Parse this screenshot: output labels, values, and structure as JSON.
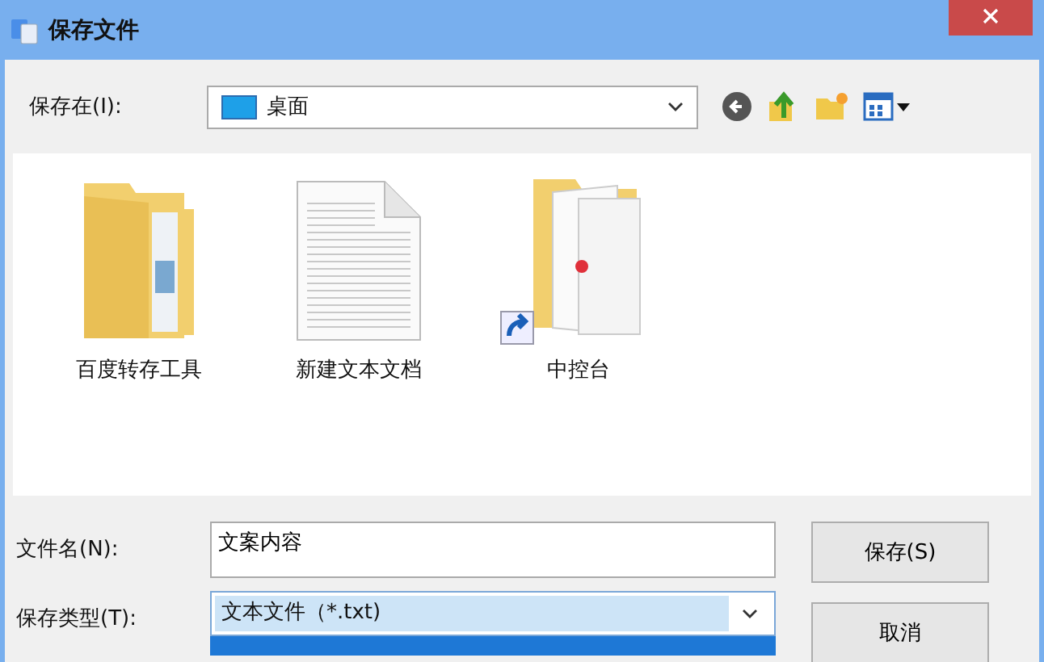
{
  "window": {
    "title": "保存文件"
  },
  "location": {
    "label": "保存在(I):",
    "value": "桌面"
  },
  "files": [
    {
      "name": "百度转存工具",
      "kind": "folder"
    },
    {
      "name": "新建文本文档",
      "kind": "document"
    },
    {
      "name": "中控台",
      "kind": "shortcut-folder"
    }
  ],
  "filename": {
    "label": "文件名(N):",
    "value": "文案内容"
  },
  "filetype": {
    "label": "保存类型(T):",
    "value": "文本文件（*.txt)",
    "dropdown_open": true
  },
  "buttons": [
    "保存(S)",
    "取消"
  ]
}
